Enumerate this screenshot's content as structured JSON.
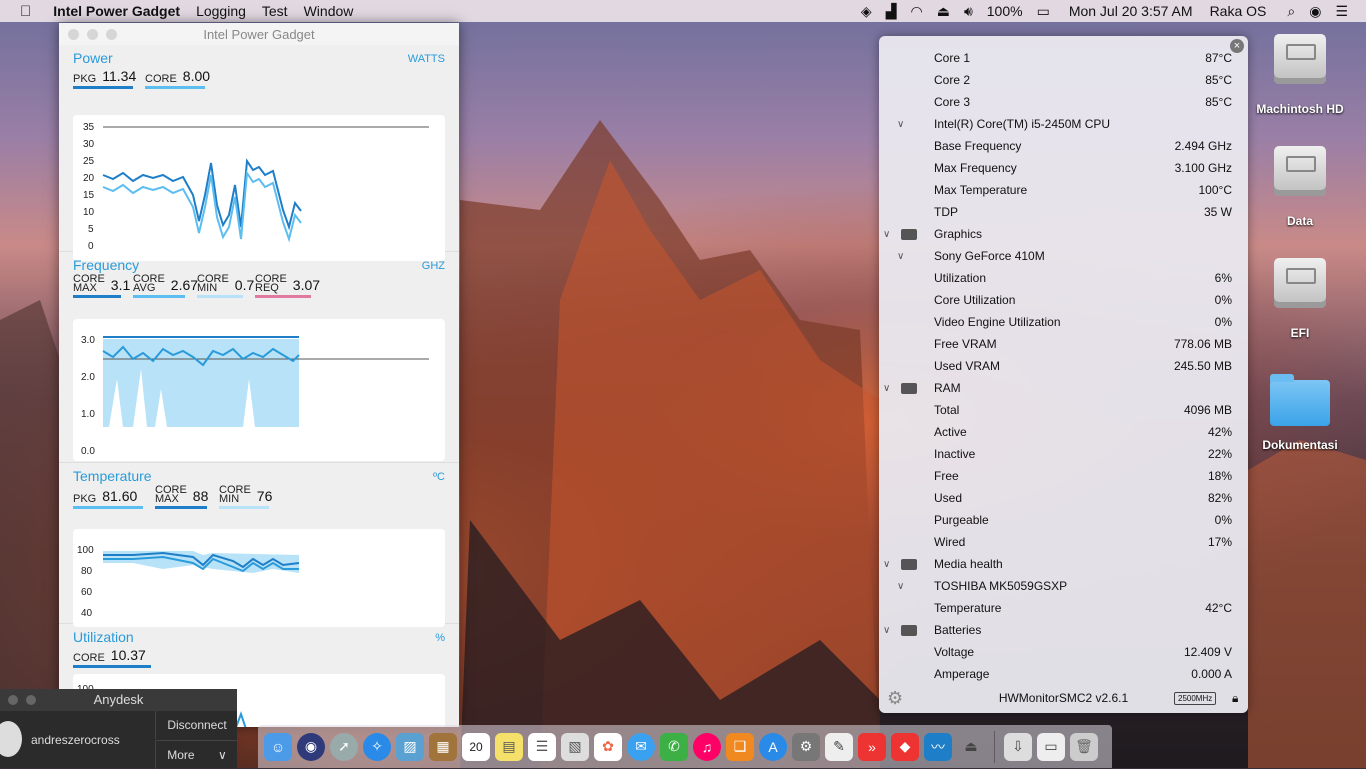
{
  "menubar": {
    "apple": "",
    "app": "Intel Power Gadget",
    "menus": [
      "Logging",
      "Test",
      "Window"
    ],
    "battery": "100%",
    "clock": "Mon Jul 20  3:57 AM",
    "user": "Raka OS"
  },
  "ipg": {
    "title": "Intel Power Gadget",
    "power": {
      "name": "Power",
      "unit": "WATTS",
      "pkg_label": "PKG",
      "pkg": "11.34",
      "core_label": "CORE",
      "core": "8.00",
      "yticks": [
        "35",
        "30",
        "25",
        "20",
        "15",
        "10",
        "5",
        "0"
      ]
    },
    "frequency": {
      "name": "Frequency",
      "unit": "GHZ",
      "max_top": "CORE",
      "max_label": "MAX",
      "max": "3.1",
      "avg_top": "CORE",
      "avg_label": "AVG",
      "avg": "2.67",
      "min_top": "CORE",
      "min_label": "MIN",
      "min": "0.7",
      "req_top": "CORE",
      "req_label": "REQ",
      "req": "3.07",
      "yticks": [
        "3.0",
        "2.0",
        "1.0",
        "0.0"
      ]
    },
    "temperature": {
      "name": "Temperature",
      "unit": "ºC",
      "pkg_label": "PKG",
      "pkg": "81.60",
      "max_top": "CORE",
      "max_label": "MAX",
      "max": "88",
      "min_top": "CORE",
      "min_label": "MIN",
      "min": "76",
      "yticks": [
        "100",
        "80",
        "60",
        "40"
      ]
    },
    "utilization": {
      "name": "Utilization",
      "unit": "%",
      "core_label": "CORE",
      "core": "10.37",
      "yticks": [
        "100"
      ]
    }
  },
  "hwmonitor": {
    "rows": [
      {
        "label": "Core 1",
        "value": "87°C",
        "level": 2
      },
      {
        "label": "Core 2",
        "value": "85°C",
        "level": 2
      },
      {
        "label": "Core 3",
        "value": "85°C",
        "level": 2
      },
      {
        "label": "Intel(R) Core(TM) i5-2450M CPU",
        "value": "",
        "level": 1,
        "chev": "∨"
      },
      {
        "label": "Base Frequency",
        "value": "2.494 GHz",
        "level": 2
      },
      {
        "label": "Max Frequency",
        "value": "3.100 GHz",
        "level": 2
      },
      {
        "label": "Max Temperature",
        "value": "100°C",
        "level": 2
      },
      {
        "label": "TDP",
        "value": "35 W",
        "level": 2
      },
      {
        "label": "Graphics",
        "value": "",
        "level": 0,
        "chev": "∨",
        "icon": true
      },
      {
        "label": "Sony GeForce 410M",
        "value": "",
        "level": 1,
        "chev": "∨"
      },
      {
        "label": "Utilization",
        "value": "6%",
        "level": 2
      },
      {
        "label": "Core Utilization",
        "value": "0%",
        "level": 2
      },
      {
        "label": "Video Engine Utilization",
        "value": "0%",
        "level": 2
      },
      {
        "label": "Free VRAM",
        "value": "778.06 MB",
        "level": 2
      },
      {
        "label": "Used VRAM",
        "value": "245.50 MB",
        "level": 2
      },
      {
        "label": "RAM",
        "value": "",
        "level": 0,
        "chev": "∨",
        "icon": true
      },
      {
        "label": "Total",
        "value": "4096 MB",
        "level": 2
      },
      {
        "label": "Active",
        "value": "42%",
        "level": 2
      },
      {
        "label": "Inactive",
        "value": "22%",
        "level": 2
      },
      {
        "label": "Free",
        "value": "18%",
        "level": 2
      },
      {
        "label": "Used",
        "value": "82%",
        "level": 2
      },
      {
        "label": "Purgeable",
        "value": "0%",
        "level": 2
      },
      {
        "label": "Wired",
        "value": "17%",
        "level": 2
      },
      {
        "label": "Media health",
        "value": "",
        "level": 0,
        "chev": "∨",
        "icon": true
      },
      {
        "label": "TOSHIBA MK5059GSXP",
        "value": "",
        "level": 1,
        "chev": "∨"
      },
      {
        "label": "Temperature",
        "value": "42°C",
        "level": 2
      },
      {
        "label": "Batteries",
        "value": "",
        "level": 0,
        "chev": "∨",
        "icon": true
      },
      {
        "label": "Voltage",
        "value": "12.409 V",
        "level": 2
      },
      {
        "label": "Amperage",
        "value": "0.000 A",
        "level": 2
      }
    ],
    "footer": "HWMonitorSMC2 v2.6.1",
    "badge": "2500MHz"
  },
  "desktop_icons": [
    "Machintosh HD",
    "Data",
    "EFI",
    "Dokumentasi"
  ],
  "anydesk": {
    "title": "Anydesk",
    "user": "andreszerocross",
    "disconnect": "Disconnect",
    "more": "More"
  },
  "dock": {
    "calendar_day": "20",
    "apps": [
      "finder",
      "siri",
      "launchpad",
      "safari",
      "preview",
      "notes-book",
      "calendar",
      "stickies",
      "reminders",
      "photos-app",
      "photos",
      "messages",
      "facetime",
      "itunes",
      "ibooks",
      "app-store",
      "system-preferences",
      "textedit",
      "anydesk",
      "anydesk-2",
      "power-gadget",
      "eject",
      "downloads",
      "documents",
      "trash"
    ]
  }
}
